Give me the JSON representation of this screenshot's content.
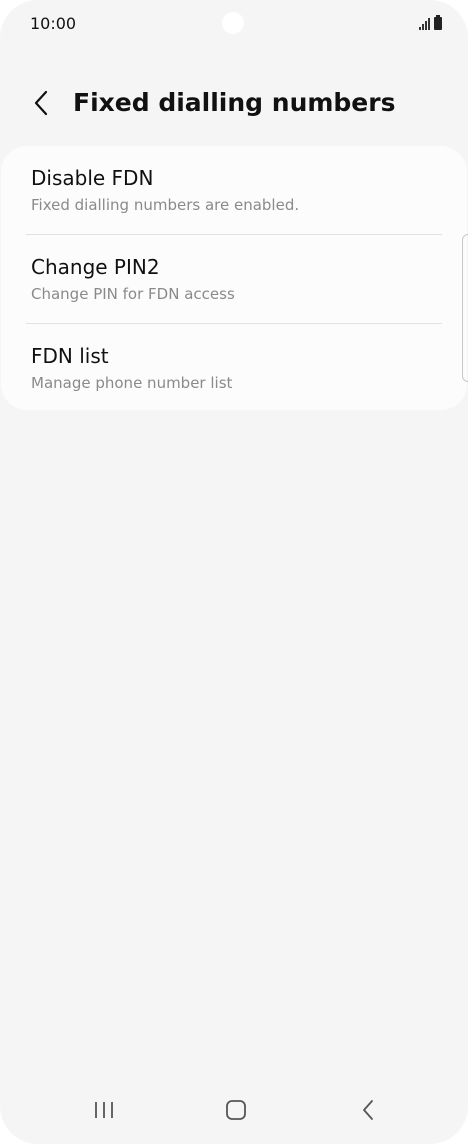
{
  "status_bar": {
    "time": "10:00"
  },
  "header": {
    "back_icon": "chevron-left-icon",
    "title": "Fixed dialling numbers"
  },
  "settings": {
    "items": [
      {
        "title": "Disable FDN",
        "subtitle": "Fixed dialling numbers are enabled."
      },
      {
        "title": "Change PIN2",
        "subtitle": "Change PIN for FDN access"
      },
      {
        "title": "FDN list",
        "subtitle": "Manage phone number list"
      }
    ]
  },
  "nav_bar": {
    "recents_icon": "recents-icon",
    "home_icon": "home-icon",
    "back_icon": "back-icon"
  },
  "colors": {
    "background": "#f5f5f5",
    "card": "#fcfcfc",
    "subtitle": "#8a8a8a"
  }
}
